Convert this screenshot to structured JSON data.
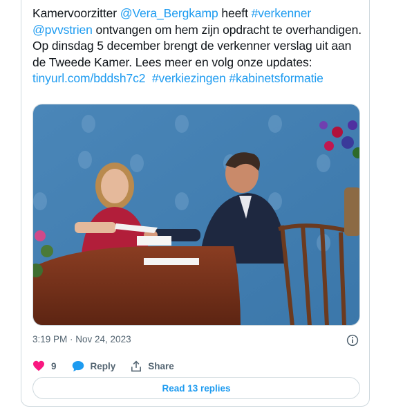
{
  "tweet": {
    "segments": [
      {
        "text": "Kamervoorzitter ",
        "kind": "text"
      },
      {
        "text": "@Vera_Bergkamp",
        "kind": "mention"
      },
      {
        "text": " heeft ",
        "kind": "text"
      },
      {
        "text": "#verkenner",
        "kind": "hashtag"
      },
      {
        "text": " ",
        "kind": "text"
      },
      {
        "text": "@pvvstrien",
        "kind": "mention"
      },
      {
        "text": " ontvangen om hem zijn opdracht te overhandigen. Op dinsdag 5 december brengt de verkenner verslag uit aan de Tweede Kamer. Lees meer en volg onze updates: ",
        "kind": "text"
      },
      {
        "text": "tinyurl.com/bddsh7c2",
        "kind": "url"
      },
      {
        "text": "  ",
        "kind": "text"
      },
      {
        "text": "#verkiezingen",
        "kind": "hashtag"
      },
      {
        "text": " ",
        "kind": "text"
      },
      {
        "text": "#kabinetsformatie",
        "kind": "hashtag"
      }
    ],
    "timestamp": "3:19 PM · Nov 24, 2023"
  },
  "actions": {
    "like_count": "9",
    "reply_label": "Reply",
    "share_label": "Share"
  },
  "read_replies_label": "Read 13 replies",
  "colors": {
    "link": "#1d9bf0",
    "heart": "#f91880",
    "text": "#0f1419",
    "muted": "#536471",
    "border": "#cfd9de"
  },
  "icons": {
    "like": "heart-icon",
    "reply": "speech-bubble-icon",
    "share": "share-arrow-icon",
    "info": "info-icon"
  }
}
